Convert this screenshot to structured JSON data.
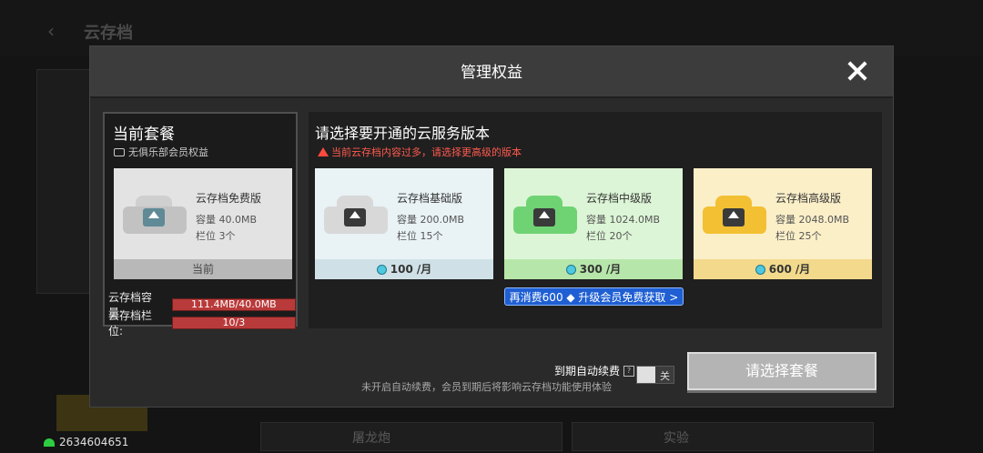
{
  "background": {
    "title": "云存档",
    "row1_label": "屠龙炮",
    "row2_label": "实验",
    "network_id": "2634604651"
  },
  "modal": {
    "title": "管理权益"
  },
  "current_plan": {
    "heading": "当前套餐",
    "membership": "无俱乐部会员权益",
    "name": "云存档免费版",
    "capacity": "容量 40.0MB",
    "slots": "栏位 3个",
    "footer": "当前",
    "storage_label": "云存档容量:",
    "storage_value": "111.4MB/40.0MB",
    "slot_label": "云存档栏位:",
    "slot_value": "10/3"
  },
  "plans": {
    "heading": "请选择要开通的云服务版本",
    "warning": "当前云存档内容过多，请选择更高级的版本",
    "items": [
      {
        "name": "云存档基础版",
        "capacity": "容量 200.0MB",
        "slots": "栏位 15个",
        "price": "100",
        "unit": "/月",
        "bg": "#e9f2f5",
        "foot": "#cfe1e6",
        "cloud": "#d8d8d8"
      },
      {
        "name": "云存档中级版",
        "capacity": "容量 1024.0MB",
        "slots": "栏位 20个",
        "price": "300",
        "unit": "/月",
        "bg": "#dcf5d6",
        "foot": "#b7e6aa",
        "cloud": "#6fd374"
      },
      {
        "name": "云存档高级版",
        "capacity": "容量 2048.0MB",
        "slots": "栏位 25个",
        "price": "600",
        "unit": "/月",
        "bg": "#fbefc8",
        "foot": "#f2d98c",
        "cloud": "#f3c033"
      }
    ],
    "upgrade_banner": "再消费600 ◆ 升级会员免费获取 >"
  },
  "footer": {
    "auto_renew_label": "到期自动续费",
    "auto_renew_note": "未开启自动续费，会员到期后将影响云存档功能使用体验",
    "toggle_state": "关",
    "choose_button": "请选择套餐"
  }
}
